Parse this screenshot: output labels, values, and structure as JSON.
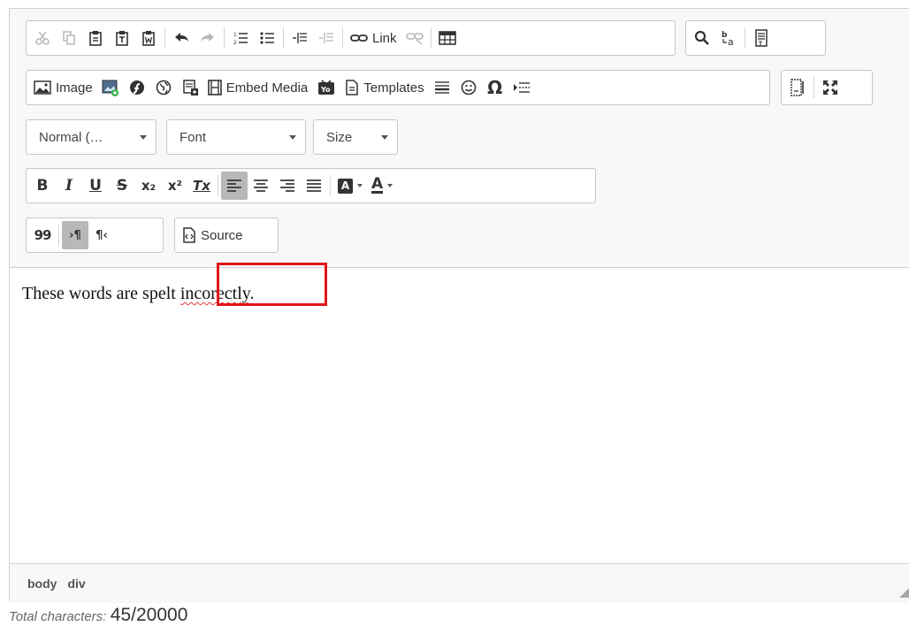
{
  "toolbar": {
    "link_label": "Link",
    "image_label": "Image",
    "embed_label": "Embed Media",
    "templates_label": "Templates",
    "source_label": "Source",
    "format_label": "Normal (…",
    "font_label": "Font",
    "size_label": "Size",
    "bold_glyph": "B",
    "italic_glyph": "I",
    "underline_glyph": "U",
    "strike_glyph": "S",
    "subscript_glyph": "x₂",
    "superscript_glyph": "x²",
    "removeformat_glyph": "Tx",
    "quote_glyph": "99",
    "ltr_glyph": "›¶",
    "rtl_glyph": "¶‹",
    "textcolor_glyph": "A",
    "bgcolor_glyph": "A",
    "omega_glyph": "Ω"
  },
  "content": {
    "text_before": "These words are spelt ",
    "misspelled_word": "incorectly",
    "text_after": "."
  },
  "statusbar": {
    "path": [
      "body",
      "div"
    ]
  },
  "footer": {
    "label": "Total characters:",
    "count": "45/20000"
  },
  "colors": {
    "highlight_border": "#e1151a",
    "spell_underline": "#e23b3b",
    "active_button": "#b8b8b8"
  }
}
